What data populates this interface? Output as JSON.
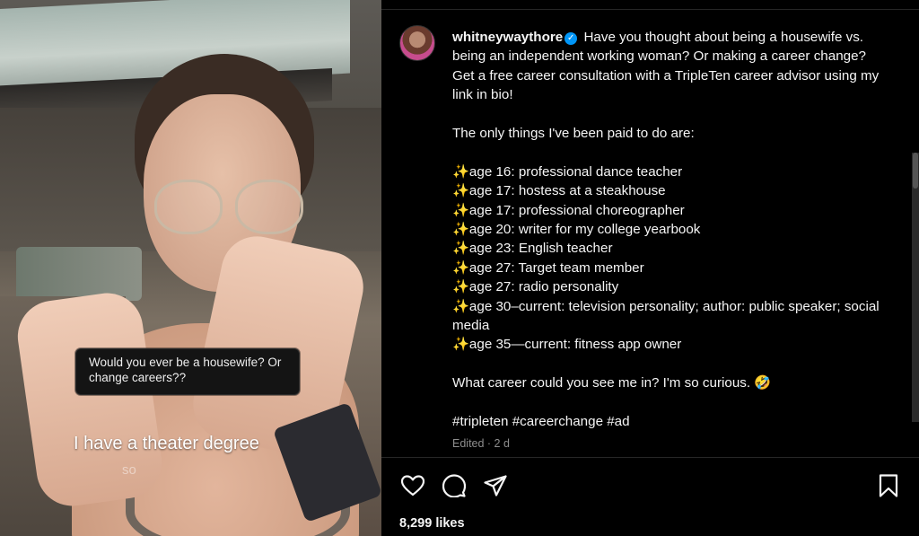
{
  "video": {
    "question_box": "Would you ever be a housewife? Or change careers??",
    "overlay_text": "I have a theater degree",
    "overlay_sub": "so"
  },
  "post": {
    "username": "whitneywaythore",
    "intro": "Have you thought about being a housewife vs. being an independent working woman? Or making a career change? Get a free career consultation with a TripleTen career advisor using my link in bio!",
    "list_heading": "The only things I've been paid to do are:",
    "jobs": [
      "age 16: professional dance teacher",
      "age 17: hostess at a steakhouse",
      "age 17: professional choreographer",
      "age 20: writer for my college yearbook",
      "age 23: English teacher",
      "age 27: Target team member",
      "age 27: radio personality",
      "age 30–current: television personality; author: public speaker; social media",
      "age 35—current: fitness app owner"
    ],
    "question": "What career could you see me in? I'm so curious.",
    "question_emoji": "🤣",
    "hashtags": "#tripleten #careerchange #ad",
    "edited": "Edited · 2 d",
    "likes": "8,299 likes"
  },
  "icons": {
    "like": "heart-icon",
    "comment": "comment-icon",
    "share": "share-icon",
    "save": "bookmark-icon",
    "verified": "verified-badge-icon",
    "sparkles": "sparkles-emoji-icon"
  },
  "colors": {
    "background": "#000000",
    "text": "#f5f5f5",
    "muted": "#8e8e8e",
    "verified": "#0095f6",
    "sparkle": "#f7c33b"
  }
}
